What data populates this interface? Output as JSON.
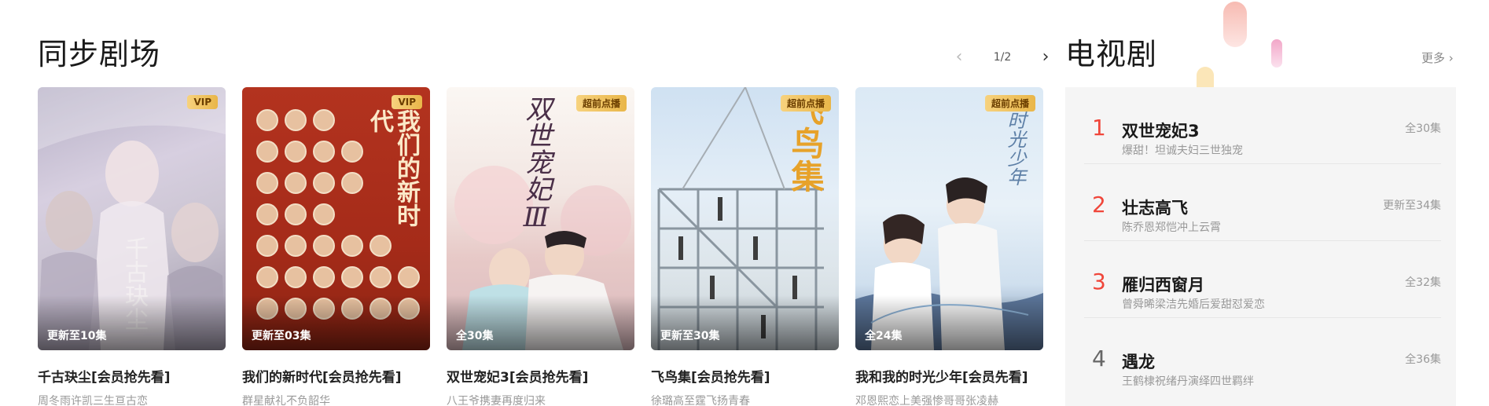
{
  "section": {
    "title": "同步剧场",
    "pager": {
      "prev": "‹",
      "page": "1/2",
      "next": "›"
    }
  },
  "cards": [
    {
      "title": "千古玦尘[会员抢先看]",
      "subtitle": "周冬雨许凯三生亘古恋",
      "badge": "VIP",
      "episodes": "更新至10集",
      "poster_text": "千古玦尘"
    },
    {
      "title": "我们的新时代[会员抢先看]",
      "subtitle": "群星献礼不负韶华",
      "badge": "VIP",
      "episodes": "更新至03集",
      "poster_text": "我们的新时代"
    },
    {
      "title": "双世宠妃3[会员抢先看]",
      "subtitle": "八王爷携妻再度归来",
      "badge": "超前点播",
      "episodes": "全30集",
      "poster_text": "双世宠妃Ⅲ"
    },
    {
      "title": "飞鸟集[会员抢先看]",
      "subtitle": "徐璐高至霆飞扬青春",
      "badge": "超前点播",
      "episodes": "更新至30集",
      "poster_text": "飞鸟集"
    },
    {
      "title": "我和我的时光少年[会员先看]",
      "subtitle": "邓恩熙恋上美强惨哥哥张凌赫",
      "badge": "超前点播",
      "episodes": "全24集",
      "poster_text": "时光少年"
    }
  ],
  "tv": {
    "title": "电视剧",
    "more": "更多 ›",
    "ranking": [
      {
        "rank": "1",
        "name": "双世宠妃3",
        "desc": "爆甜！坦诚夫妇三世独宠",
        "count": "全30集"
      },
      {
        "rank": "2",
        "name": "壮志高飞",
        "desc": "陈乔恩郑恺冲上云霄",
        "count": "更新至34集"
      },
      {
        "rank": "3",
        "name": "雁归西窗月",
        "desc": "曾舜晞梁洁先婚后爱甜怼爱恋",
        "count": "全32集"
      },
      {
        "rank": "4",
        "name": "遇龙",
        "desc": "王鹤棣祝绪丹演绎四世羁绊",
        "count": "全36集"
      }
    ]
  },
  "colors": {
    "rank_top": "#f0463a",
    "rank_other": "#666666",
    "badge_gold": "#e9b649"
  }
}
